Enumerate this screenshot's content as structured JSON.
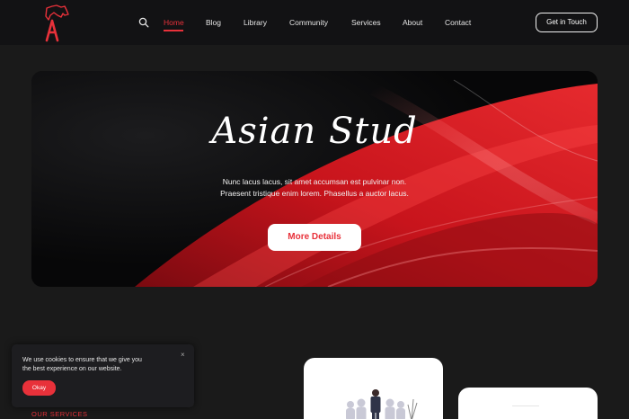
{
  "brand": {
    "logo_letter": "A",
    "accent_color": "#e8313a"
  },
  "nav": {
    "items": [
      {
        "label": "Home",
        "active": true
      },
      {
        "label": "Blog",
        "active": false
      },
      {
        "label": "Library",
        "active": false
      },
      {
        "label": "Community",
        "active": false
      },
      {
        "label": "Services",
        "active": false
      },
      {
        "label": "About",
        "active": false
      },
      {
        "label": "Contact",
        "active": false
      }
    ],
    "cta_label": "Get in Touch",
    "search_icon": "search-icon"
  },
  "hero": {
    "title": "Asian Stud",
    "line1": "Nunc lacus lacus, sit amet accumsan est pulvinar non.",
    "line2": "Praesent tristique enim lorem. Phasellus a auctor lacus.",
    "button_label": "More Details"
  },
  "services": {
    "label": "OUR SERVICES"
  },
  "cookie": {
    "line1": "We use cookies to ensure that we give you",
    "line2": "the best experience on our website.",
    "ok_label": "Okay",
    "close_glyph": "×"
  }
}
